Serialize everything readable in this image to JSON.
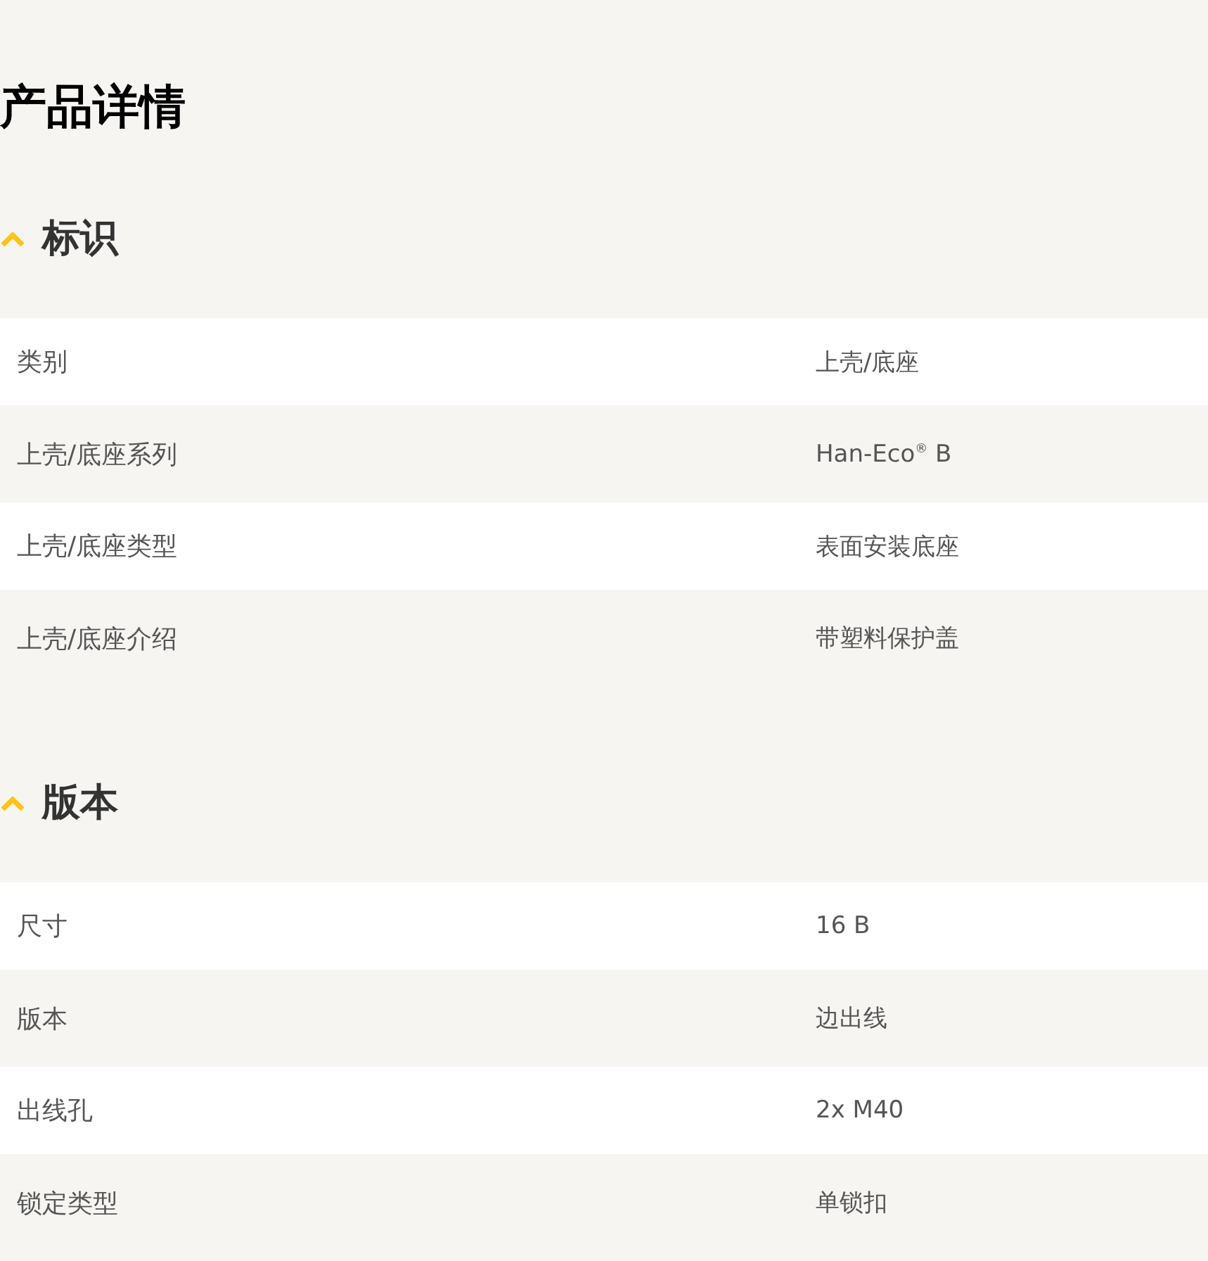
{
  "title": "产品详情",
  "sections": [
    {
      "heading": "标识",
      "expanded": true,
      "rows": [
        {
          "label": "类别",
          "value": "上壳/底座"
        },
        {
          "label": "上壳/底座系列",
          "value": "Han-Eco$^{®}$ B"
        },
        {
          "label": "上壳/底座类型",
          "value": "表面安装底座"
        },
        {
          "label": "上壳/底座介绍",
          "value": "带塑料保护盖"
        }
      ]
    },
    {
      "heading": "版本",
      "expanded": true,
      "rows": [
        {
          "label": "尺寸",
          "value": "16 B"
        },
        {
          "label": "版本",
          "value": "边出线"
        },
        {
          "label": "出线孔",
          "value": "2x M40"
        },
        {
          "label": "锁定类型",
          "value": "单锁扣"
        }
      ]
    }
  ]
}
